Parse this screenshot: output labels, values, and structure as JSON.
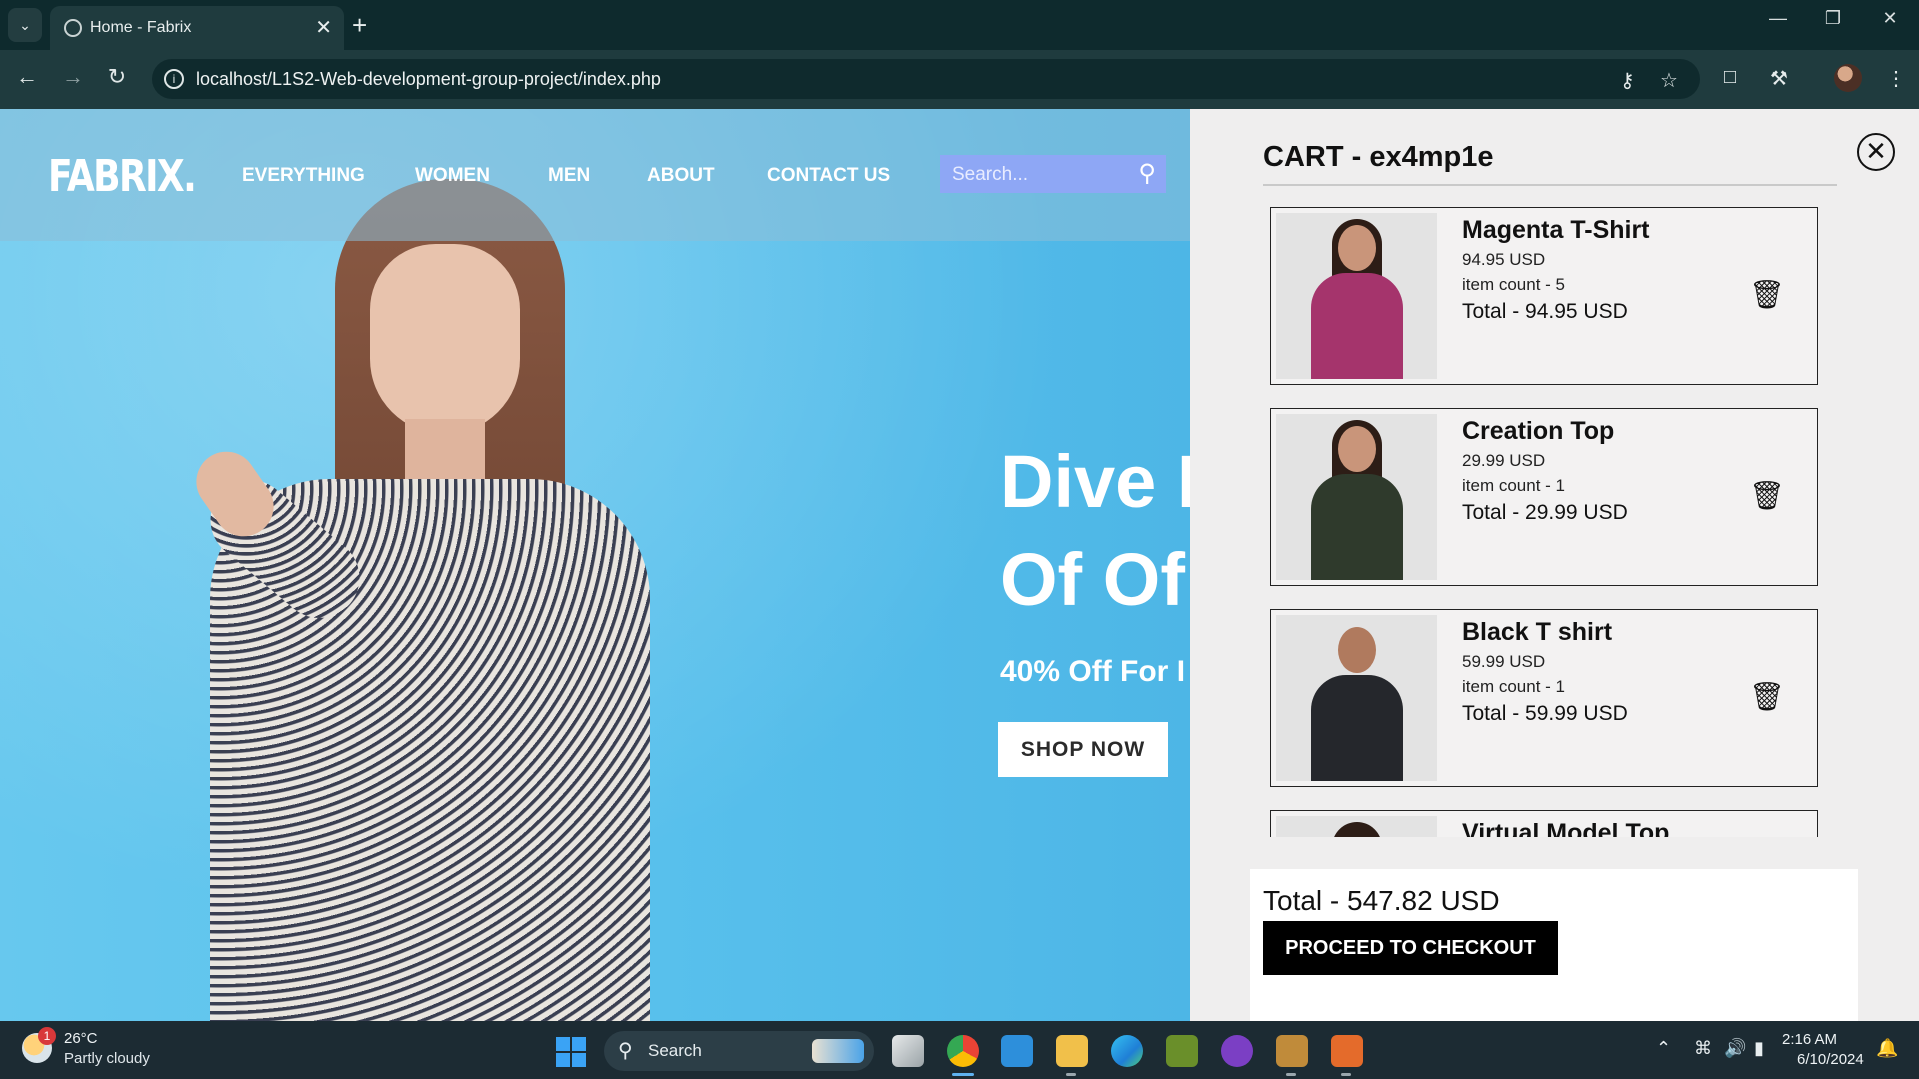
{
  "browser": {
    "tab_title": "Home - Fabrix",
    "url": "localhost/L1S2-Web-development-group-project/index.php",
    "icons": [
      "tab-search-icon",
      "close-icon",
      "new-tab-icon",
      "back-icon",
      "forward-icon",
      "reload-icon",
      "site-info-icon",
      "password-key-icon",
      "bookmark-star-icon",
      "reading-list-icon",
      "extensions-icon",
      "profile-avatar",
      "menu-dots-icon",
      "minimize-icon",
      "restore-icon",
      "window-close-icon"
    ]
  },
  "site": {
    "logo": "FABRIX.",
    "nav": [
      "EVERYTHING",
      "WOMEN",
      "MEN",
      "ABOUT",
      "CONTACT US"
    ],
    "search_placeholder": "Search...",
    "hero": {
      "line1": "Dive I",
      "line2": "Of Of",
      "subline": "40% Off For I",
      "cta": "SHOP NOW"
    }
  },
  "cart": {
    "title": "CART - ex4mp1e",
    "items": [
      {
        "name": "Magenta T-Shirt",
        "price": "94.95 USD",
        "count": "item count - 5",
        "total": "Total - 94.95 USD",
        "color": "#a5346c"
      },
      {
        "name": "Creation Top",
        "price": "29.99 USD",
        "count": "item count - 1",
        "total": "Total - 29.99 USD",
        "color": "#2f3a2c"
      },
      {
        "name": "Black T shirt",
        "price": "59.99 USD",
        "count": "item count - 1",
        "total": "Total - 59.99 USD",
        "color": "#25272c"
      },
      {
        "name": "Virtual Model Top",
        "price": "",
        "count": "",
        "total": "",
        "color": "#ead9c8"
      }
    ],
    "grand_total": "Total - 547.82 USD",
    "checkout_label": "PROCEED TO CHECKOUT"
  },
  "taskbar": {
    "weather_badge": "1",
    "temperature": "26°C",
    "condition": "Partly cloudy",
    "search_label": "Search",
    "time": "2:16 AM",
    "date": "6/10/2024"
  },
  "colors": {
    "hero_bg": "#5ec5ec",
    "cart_bg": "#efeeee",
    "checkout_bg": "#000000",
    "taskbar_bg": "#1c2b33"
  }
}
